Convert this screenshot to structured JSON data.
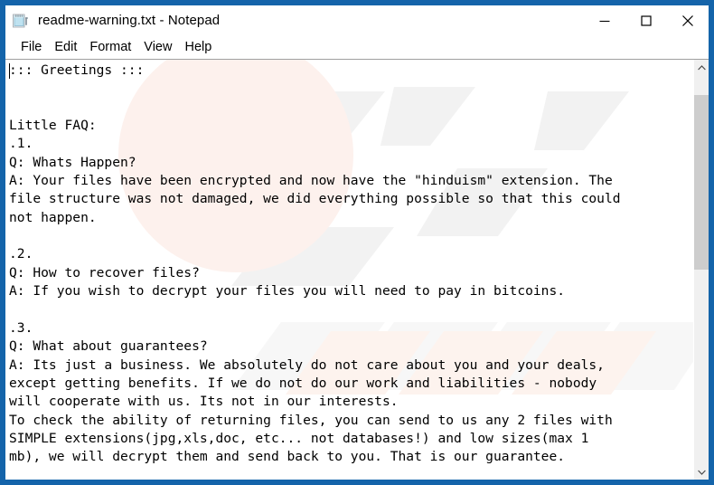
{
  "window": {
    "title": "readme-warning.txt - Notepad",
    "icon": "notepad-icon",
    "buttons": {
      "minimize": "—",
      "maximize": "□",
      "close": "✕"
    },
    "frame_color": "#1464aa"
  },
  "menu": {
    "items": [
      {
        "label": "File"
      },
      {
        "label": "Edit"
      },
      {
        "label": "Format"
      },
      {
        "label": "View"
      },
      {
        "label": "Help"
      }
    ]
  },
  "editor": {
    "text": "::: Greetings :::\n\n\nLittle FAQ:\n.1.\nQ: Whats Happen?\nA: Your files have been encrypted and now have the \"hinduism\" extension. The\nfile structure was not damaged, we did everything possible so that this could\nnot happen.\n\n.2.\nQ: How to recover files?\nA: If you wish to decrypt your files you will need to pay in bitcoins.\n\n.3.\nQ: What about guarantees?\nA: Its just a business. We absolutely do not care about you and your deals,\nexcept getting benefits. If we do not do our work and liabilities - nobody\nwill cooperate with us. Its not in our interests.\nTo check the ability of returning files, you can send to us any 2 files with\nSIMPLE extensions(jpg,xls,doc, etc... not databases!) and low sizes(max 1\nmb), we will decrypt them and send back to you. That is our guarantee.",
    "caret_visible": true,
    "ransom_extension": "hinduism",
    "lines": [
      "::: Greetings :::",
      "",
      "",
      "Little FAQ:",
      ".1.",
      "Q: Whats Happen?",
      "A: Your files have been encrypted and now have the \"hinduism\" extension. The",
      "file structure was not damaged, we did everything possible so that this could",
      "not happen.",
      "",
      ".2.",
      "Q: How to recover files?",
      "A: If you wish to decrypt your files you will need to pay in bitcoins.",
      "",
      ".3.",
      "Q: What about guarantees?",
      "A: Its just a business. We absolutely do not care about you and your deals,",
      "except getting benefits. If we do not do our work and liabilities - nobody",
      "will cooperate with us. Its not in our interests.",
      "To check the ability of returning files, you can send to us any 2 files with",
      "SIMPLE extensions(jpg,xls,doc, etc... not databases!) and low sizes(max 1",
      "mb), we will decrypt them and send back to you. That is our guarantee."
    ]
  },
  "scrollbar": {
    "up_arrow": "⌃",
    "down_arrow": "⌄",
    "thumb_top_pct": 5,
    "thumb_height_pct": 45
  }
}
